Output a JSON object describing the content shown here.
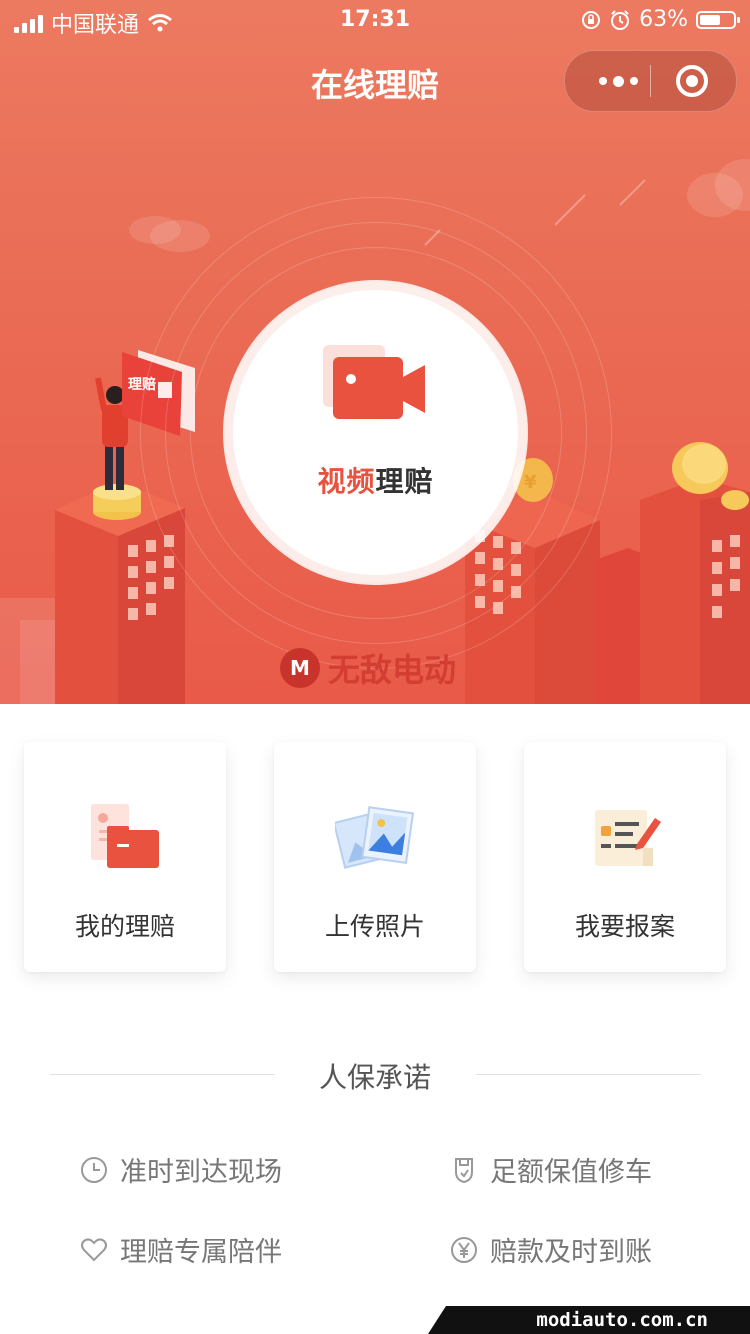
{
  "status_bar": {
    "carrier": "中国联通",
    "time": "17:31",
    "battery": "63%",
    "battery_level": 0.63
  },
  "nav": {
    "title": "在线理赔",
    "more_icon": "more-dots-icon",
    "close_icon": "target-circle-icon"
  },
  "hero": {
    "main_label_accent": "视频",
    "main_label_rest": "理赔",
    "main_icon": "video-camera-icon",
    "sign_text": "理赔",
    "watermark": "无敌电动",
    "colors": {
      "top": "#ec7a60",
      "bottom": "#e95a48",
      "accent": "#e8523e"
    }
  },
  "cards": [
    {
      "label": "我的理赔",
      "icon": "claim-folder-icon"
    },
    {
      "label": "上传照片",
      "icon": "photo-upload-icon"
    },
    {
      "label": "我要报案",
      "icon": "report-form-icon"
    }
  ],
  "promise": {
    "title": "人保承诺",
    "items": [
      {
        "label": "准时到达现场",
        "icon": "clock-icon"
      },
      {
        "label": "足额保值修车",
        "icon": "shield-icon"
      },
      {
        "label": "理赔专属陪伴",
        "icon": "heart-icon"
      },
      {
        "label": "赔款及时到账",
        "icon": "yen-icon"
      }
    ]
  },
  "footer_watermark": "modiauto.com.cn"
}
